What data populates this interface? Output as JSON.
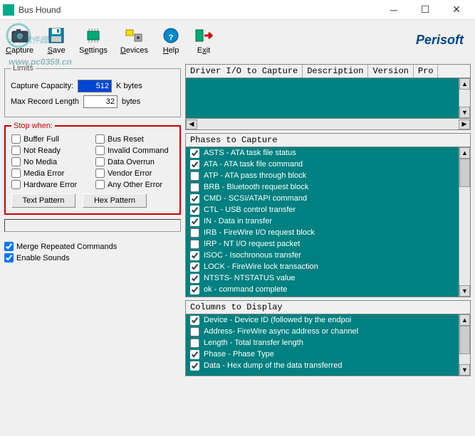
{
  "window": {
    "title": "Bus Hound"
  },
  "watermark": "河东软件园",
  "watermark_url": "www.pc0359.cn",
  "brand": "Perisoft",
  "toolbar": {
    "capture": "Capture",
    "save": "Save",
    "settings": "Settings",
    "devices": "Devices",
    "help": "Help",
    "exit": "Exit"
  },
  "limits": {
    "legend": "Limits",
    "capacity_label": "Capture Capacity:",
    "capacity_value": "512",
    "capacity_unit": "K bytes",
    "maxlen_label": "Max Record Length",
    "maxlen_value": "32",
    "maxlen_unit": "bytes"
  },
  "stopwhen": {
    "legend": "Stop when:",
    "items": [
      {
        "label": "Buffer Full",
        "checked": false
      },
      {
        "label": "Bus Reset",
        "checked": false
      },
      {
        "label": "Not Ready",
        "checked": false
      },
      {
        "label": "Invalid Command",
        "checked": false
      },
      {
        "label": "No Media",
        "checked": false
      },
      {
        "label": "Data Overrun",
        "checked": false
      },
      {
        "label": "Media Error",
        "checked": false
      },
      {
        "label": "Vendor Error",
        "checked": false
      },
      {
        "label": "Hardware Error",
        "checked": false
      },
      {
        "label": "Any Other Error",
        "checked": false
      }
    ],
    "text_pattern": "Text Pattern",
    "hex_pattern": "Hex Pattern"
  },
  "options": {
    "merge": {
      "label": "Merge Repeated Commands",
      "checked": true
    },
    "sounds": {
      "label": "Enable Sounds",
      "checked": true
    }
  },
  "driver_panel": {
    "headers": [
      "Driver I/O to Capture",
      "Description",
      "Version",
      "Pro"
    ]
  },
  "phases": {
    "title": "Phases to Capture",
    "items": [
      {
        "label": "ASTS - ATA task file status",
        "checked": true
      },
      {
        "label": "ATA  - ATA task file command",
        "checked": true
      },
      {
        "label": "ATP  - ATA pass through block",
        "checked": false
      },
      {
        "label": "BRB  - Bluetooth request block",
        "checked": false
      },
      {
        "label": "CMD  - SCSI/ATAPI command",
        "checked": true
      },
      {
        "label": "CTL  - USB control transfer",
        "checked": true
      },
      {
        "label": "IN   - Data in transfer",
        "checked": true
      },
      {
        "label": "IRB  - FireWire I/O request block",
        "checked": false
      },
      {
        "label": "IRP  - NT I/O request packet",
        "checked": false
      },
      {
        "label": "ISOC - Isochronous transfer",
        "checked": true
      },
      {
        "label": "LOCK - FireWire lock transaction",
        "checked": true
      },
      {
        "label": "NTSTS- NTSTATUS value",
        "checked": true
      },
      {
        "label": "ok   - command complete",
        "checked": true
      }
    ]
  },
  "columns": {
    "title": "Columns to Display",
    "items": [
      {
        "label": "Device - Device ID (followed by the endpoi",
        "checked": true
      },
      {
        "label": "Address- FireWire async address or channel",
        "checked": false
      },
      {
        "label": "Length - Total transfer length",
        "checked": false
      },
      {
        "label": "Phase  - Phase Type",
        "checked": true
      },
      {
        "label": "Data   - Hex dump of the data transferred",
        "checked": true
      }
    ]
  }
}
